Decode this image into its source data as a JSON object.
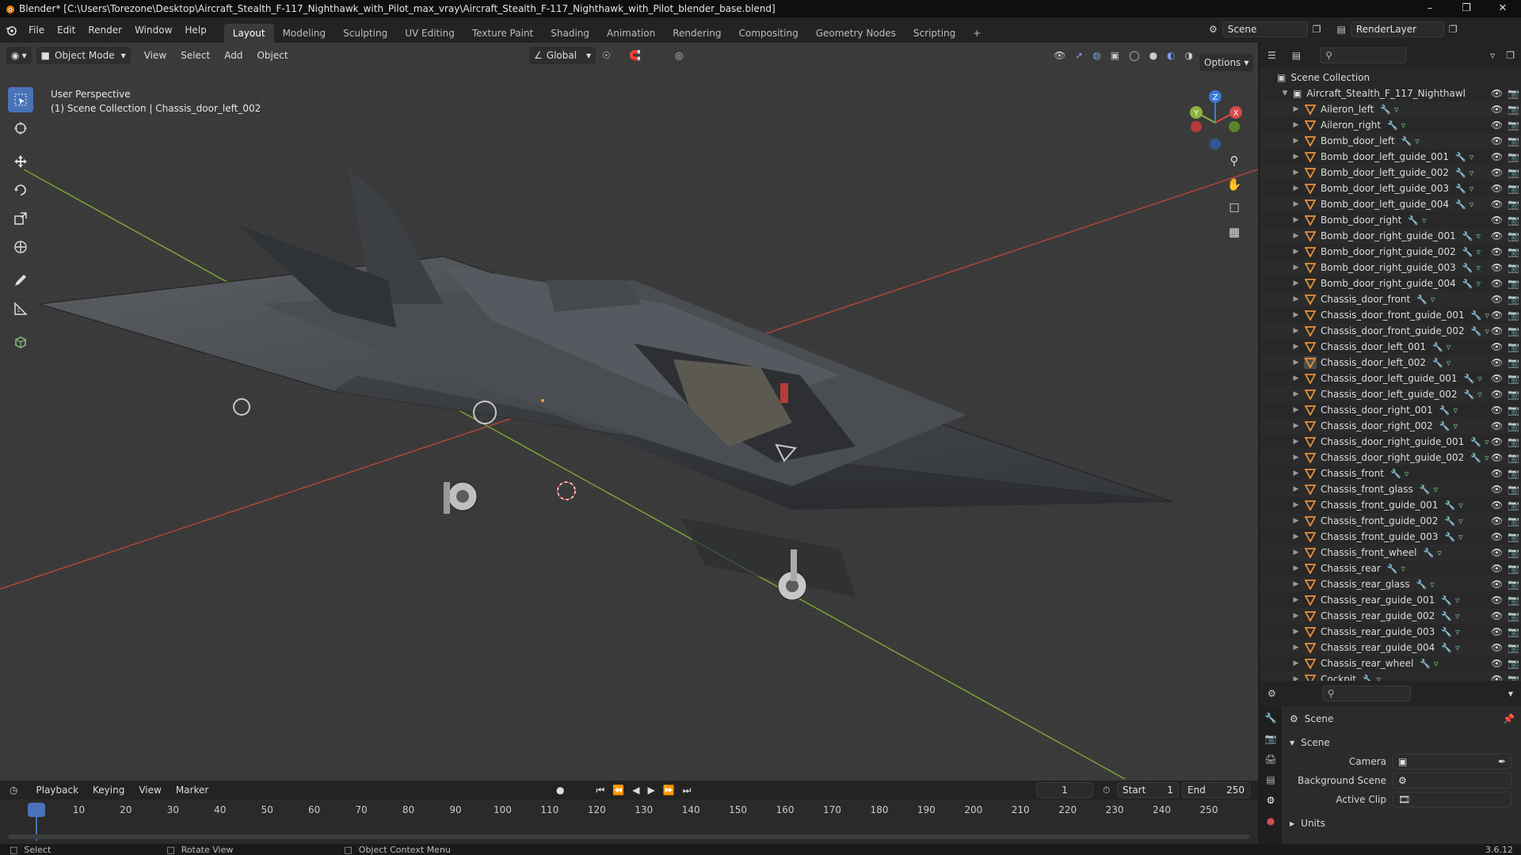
{
  "window": {
    "title": "Blender* [C:\\Users\\Torezone\\Desktop\\Aircraft_Stealth_F-117_Nighthawk_with_Pilot_max_vray\\Aircraft_Stealth_F-117_Nighthawk_with_Pilot_blender_base.blend]",
    "min": "–",
    "max": "❐",
    "close": "✕"
  },
  "menu": [
    "File",
    "Edit",
    "Render",
    "Window",
    "Help"
  ],
  "workspaces": [
    "Layout",
    "Modeling",
    "Sculpting",
    "UV Editing",
    "Texture Paint",
    "Shading",
    "Animation",
    "Rendering",
    "Compositing",
    "Geometry Nodes",
    "Scripting",
    "+"
  ],
  "scene_name": "Scene",
  "view_layer": "RenderLayer",
  "viewport": {
    "mode": "Object Mode",
    "menus": [
      "View",
      "Select",
      "Add",
      "Object"
    ],
    "transform": "Global",
    "options": "Options",
    "perspective": "User Perspective",
    "context": "(1) Scene Collection | Chassis_door_left_002",
    "gizmo": {
      "x": "X",
      "y": "Y",
      "z": "Z"
    }
  },
  "outliner": {
    "root": "Scene Collection",
    "collection": "Aircraft_Stealth_F_117_Nighthawk_with",
    "items": [
      "Aileron_left",
      "Aileron_right",
      "Bomb_door_left",
      "Bomb_door_left_guide_001",
      "Bomb_door_left_guide_002",
      "Bomb_door_left_guide_003",
      "Bomb_door_left_guide_004",
      "Bomb_door_right",
      "Bomb_door_right_guide_001",
      "Bomb_door_right_guide_002",
      "Bomb_door_right_guide_003",
      "Bomb_door_right_guide_004",
      "Chassis_door_front",
      "Chassis_door_front_guide_001",
      "Chassis_door_front_guide_002",
      "Chassis_door_left_001",
      "Chassis_door_left_002",
      "Chassis_door_left_guide_001",
      "Chassis_door_left_guide_002",
      "Chassis_door_right_001",
      "Chassis_door_right_002",
      "Chassis_door_right_guide_001",
      "Chassis_door_right_guide_002",
      "Chassis_front",
      "Chassis_front_glass",
      "Chassis_front_guide_001",
      "Chassis_front_guide_002",
      "Chassis_front_guide_003",
      "Chassis_front_wheel",
      "Chassis_rear",
      "Chassis_rear_glass",
      "Chassis_rear_guide_001",
      "Chassis_rear_guide_002",
      "Chassis_rear_guide_003",
      "Chassis_rear_guide_004",
      "Chassis_rear_wheel",
      "Cockpit"
    ],
    "selected_index": 16
  },
  "properties": {
    "header": "Scene",
    "section": "Scene",
    "camera_label": "Camera",
    "background_label": "Background Scene",
    "clip_label": "Active Clip",
    "units_label": "Units"
  },
  "timeline": {
    "menus": [
      "Playback",
      "Keying",
      "View",
      "Marker"
    ],
    "current_frame": "1",
    "start_label": "Start",
    "start": "1",
    "end_label": "End",
    "end": "250",
    "ticks": [
      "1",
      "10",
      "20",
      "30",
      "40",
      "50",
      "60",
      "70",
      "80",
      "90",
      "100",
      "110",
      "120",
      "130",
      "140",
      "150",
      "160",
      "170",
      "180",
      "190",
      "200",
      "210",
      "220",
      "230",
      "240",
      "250"
    ]
  },
  "status": {
    "select": "Select",
    "rotate": "Rotate View",
    "context_menu": "Object Context Menu",
    "version": "3.6.12"
  },
  "colors": {
    "accent": "#4a72b8",
    "object_orange": "#e8913a",
    "modifier_blue": "#7a9be0",
    "mesh_green": "#6fd18b",
    "grid_red": "#b3433f",
    "grid_green": "#7da234"
  }
}
